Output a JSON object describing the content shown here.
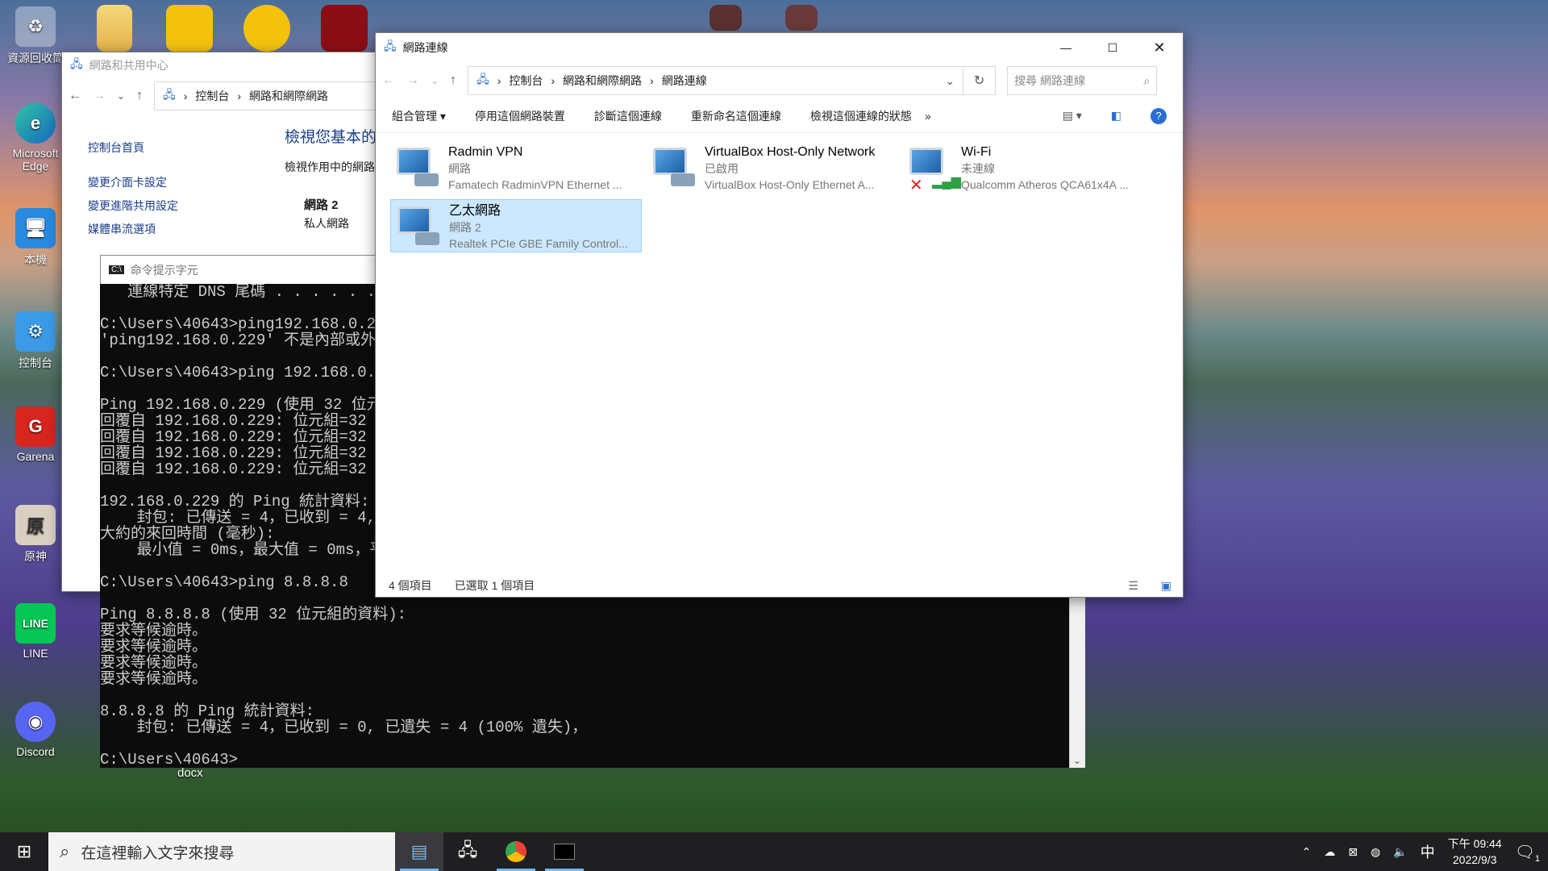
{
  "desktop": {
    "icons": [
      {
        "label": "資源回收筒"
      },
      {
        "label": "Microsoft Edge"
      },
      {
        "label": "本機"
      },
      {
        "label": "控制台"
      },
      {
        "label": "Garena"
      },
      {
        "label": "原神"
      },
      {
        "label": "LINE"
      },
      {
        "label": "Discord"
      }
    ],
    "docx_label": "docx"
  },
  "ncenter": {
    "title": "網路和共用中心",
    "crumbs": [
      "控制台",
      "網路和網際網路"
    ],
    "side_links": [
      "控制台首頁",
      "變更介面卡設定",
      "變更進階共用設定",
      "媒體串流選項"
    ],
    "heading": "檢視您基本的",
    "sub": "檢視作用中的網路",
    "network_name": "網路 2",
    "network_type": "私人網路"
  },
  "cmd": {
    "title": "命令提示字元",
    "lines": [
      "   連線特定 DNS 尾碼 . . . . . . . . :",
      "",
      "C:\\Users\\40643>ping192.168.0.229",
      "'ping192.168.0.229' 不是內部或外部命令",
      "",
      "C:\\Users\\40643>ping 192.168.0.229",
      "",
      "Ping 192.168.0.229 (使用 32 位元組",
      "回覆自 192.168.0.229: 位元組=32 時",
      "回覆自 192.168.0.229: 位元組=32 時",
      "回覆自 192.168.0.229: 位元組=32 時",
      "回覆自 192.168.0.229: 位元組=32 時",
      "",
      "192.168.0.229 的 Ping 統計資料:",
      "    封包: 已傳送 = 4，已收到 = 4,",
      "大約的來回時間 (毫秒):",
      "    最小值 = 0ms，最大值 = 0ms，平",
      "",
      "C:\\Users\\40643>ping 8.8.8.8",
      "",
      "Ping 8.8.8.8 (使用 32 位元組的資料):",
      "要求等候逾時。",
      "要求等候逾時。",
      "要求等候逾時。",
      "要求等候逾時。",
      "",
      "8.8.8.8 的 Ping 統計資料:",
      "    封包: 已傳送 = 4，已收到 = 0, 已遺失 = 4 (100% 遺失)，",
      "",
      "C:\\Users\\40643>"
    ]
  },
  "netconn": {
    "title": "網路連線",
    "crumbs": [
      "控制台",
      "網路和網際網路",
      "網路連線"
    ],
    "search_placeholder": "搜尋 網路連線",
    "ribbon": [
      "組合管理 ▾",
      "停用這個網路裝置",
      "診斷這個連線",
      "重新命名這個連線",
      "檢視這個連線的狀態",
      "»"
    ],
    "items": [
      {
        "name": "Radmin VPN",
        "status": "網路",
        "device": "Famatech RadminVPN Ethernet ..."
      },
      {
        "name": "VirtualBox Host-Only Network",
        "status": "已啟用",
        "device": "VirtualBox Host-Only Ethernet A..."
      },
      {
        "name": "Wi-Fi",
        "status": "未連線",
        "device": "Qualcomm Atheros QCA61x4A ..."
      },
      {
        "name": "乙太網路",
        "status": "網路 2",
        "device": "Realtek PCIe GBE Family Control..."
      }
    ],
    "status_count": "4 個項目",
    "status_selected": "已選取 1 個項目"
  },
  "taskbar": {
    "search_placeholder": "在這裡輸入文字來搜尋",
    "ime": "中",
    "time": "下午 09:44",
    "date": "2022/9/3",
    "notif_count": "1"
  }
}
